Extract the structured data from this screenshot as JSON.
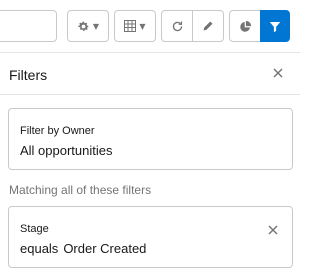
{
  "toolbar": {
    "search_placeholder": "",
    "buttons": [
      "settings-menu",
      "display-as-menu",
      "refresh",
      "edit-list",
      "charts",
      "filters"
    ]
  },
  "panel": {
    "title": "Filters"
  },
  "filters": {
    "owner": {
      "label": "Filter by Owner",
      "value": "All opportunities"
    },
    "section_note": "Matching all of these filters",
    "items": [
      {
        "field": "Stage",
        "operator": "equals",
        "value": "Order Created"
      }
    ]
  },
  "colors": {
    "accent": "#0176d3",
    "border": "#c9c9c9",
    "muted_text": "#747474",
    "text": "#181818"
  },
  "icons": [
    "gear-icon",
    "table-icon",
    "refresh-icon",
    "pencil-icon",
    "pie-chart-icon",
    "filter-funnel-icon",
    "close-icon"
  ]
}
